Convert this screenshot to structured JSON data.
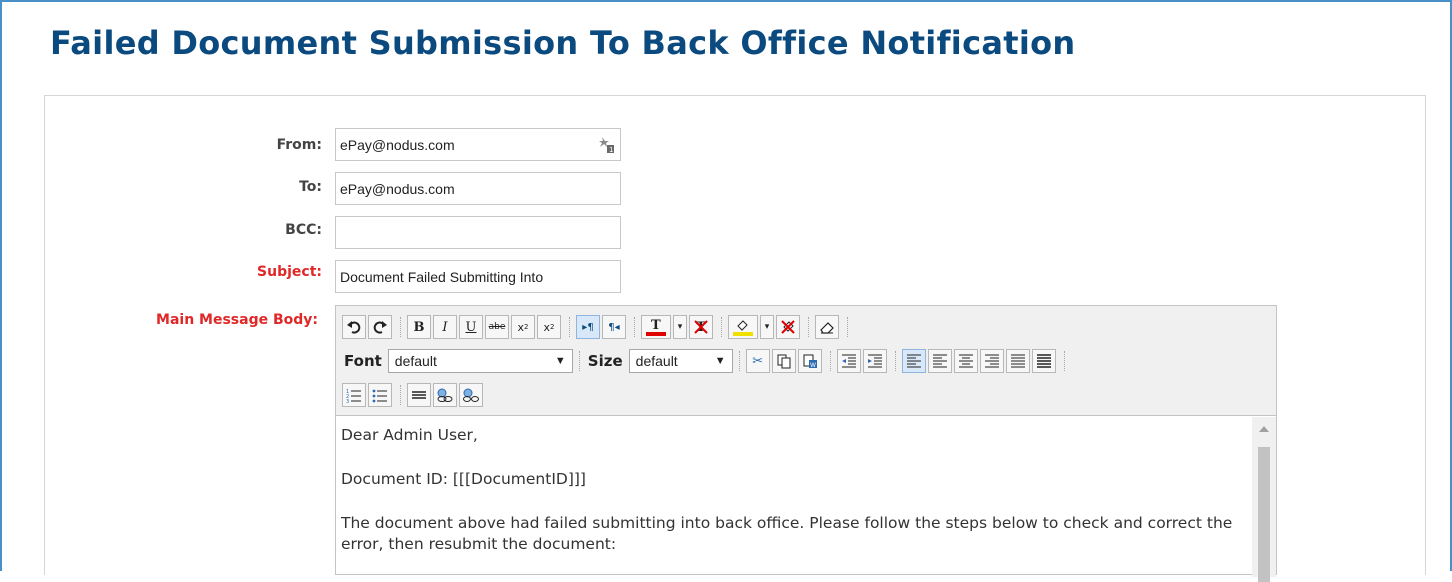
{
  "page": {
    "title": "Failed Document Submission To Back Office Notification"
  },
  "form": {
    "from": {
      "label": "From:",
      "value": "ePay@nodus.com"
    },
    "to": {
      "label": "To:",
      "value": "ePay@nodus.com"
    },
    "bcc": {
      "label": "BCC:",
      "value": ""
    },
    "subject": {
      "label": "Subject:",
      "value": "Document Failed Submitting Into"
    },
    "body_label": "Main Message Body:"
  },
  "editor": {
    "font_label": "Font",
    "font_value": "default",
    "size_label": "Size",
    "size_value": "default",
    "paragraphs": [
      "Dear Admin User,",
      "Document ID: [[[DocumentID]]]",
      "The document above had failed submitting into back office. Please follow the steps below to check and correct the error, then resubmit the document:"
    ]
  },
  "colors": {
    "title": "#0b4a7f",
    "required_label": "#e02828",
    "frame_border": "#4a90c8",
    "font_color_bar": "#e00000",
    "highlight_bar": "#f0e000"
  },
  "icons": {
    "from_addon": "address-book-icon",
    "toolbar": [
      "undo-icon",
      "redo-icon",
      "bold-icon",
      "italic-icon",
      "underline-icon",
      "strikethrough-icon",
      "subscript-icon",
      "superscript-icon",
      "ltr-icon",
      "rtl-icon",
      "font-color-icon",
      "remove-font-color-icon",
      "highlight-icon",
      "remove-highlight-icon",
      "eraser-icon",
      "cut-icon",
      "copy-icon",
      "paste-word-icon",
      "outdent-icon",
      "indent-icon",
      "justify-left-icon",
      "align-left-icon",
      "align-center-icon",
      "align-right-icon",
      "justify-full-icon",
      "justify-none-icon",
      "ordered-list-icon",
      "unordered-list-icon",
      "horizontal-rule-icon",
      "insert-link-icon",
      "remove-link-icon"
    ]
  }
}
